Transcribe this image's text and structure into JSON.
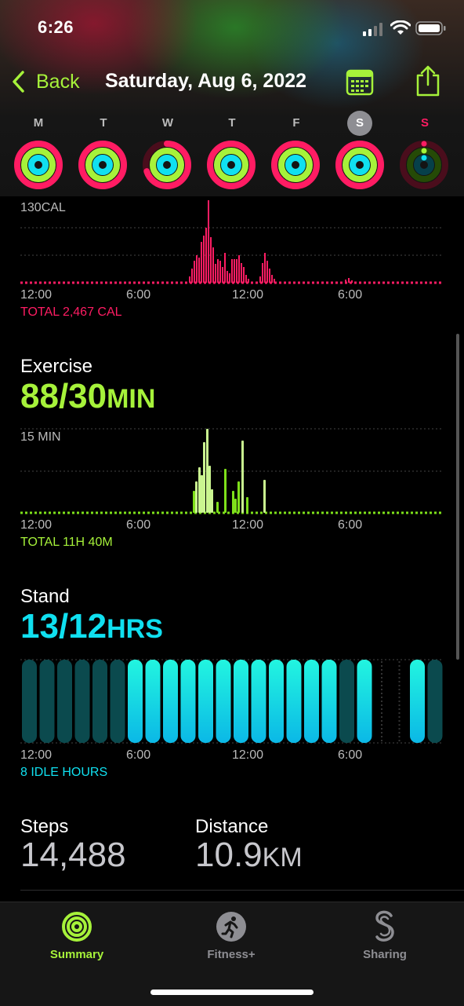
{
  "status": {
    "time": "6:26"
  },
  "nav": {
    "back_label": "Back",
    "title": "Saturday, Aug 6, 2022"
  },
  "week": {
    "days": [
      "M",
      "T",
      "W",
      "T",
      "F",
      "S",
      "S"
    ],
    "selected_index": 5,
    "today_index": 6
  },
  "move": {
    "scale_label": "130CAL",
    "x_labels": [
      "12:00",
      "6:00",
      "12:00",
      "6:00"
    ],
    "total": "TOTAL 2,467 CAL",
    "color": "#ff1c63"
  },
  "exercise": {
    "title": "Exercise",
    "value": "88/30",
    "unit": "MIN",
    "scale_label": "15 MIN",
    "x_labels": [
      "12:00",
      "6:00",
      "12:00",
      "6:00"
    ],
    "total": "TOTAL 11H 40M",
    "color": "#a6f23a"
  },
  "stand": {
    "title": "Stand",
    "value": "13/12",
    "unit": "HRS",
    "x_labels": [
      "12:00",
      "6:00",
      "12:00",
      "6:00"
    ],
    "idle": "8 IDLE HOURS",
    "color": "#10e0f0"
  },
  "steps": {
    "title": "Steps",
    "value": "14,488"
  },
  "distance": {
    "title": "Distance",
    "value": "10.9",
    "unit": "KM"
  },
  "tabs": [
    {
      "label": "Summary",
      "icon": "activity-rings-icon",
      "active": true
    },
    {
      "label": "Fitness+",
      "icon": "running-figure-icon",
      "active": false
    },
    {
      "label": "Sharing",
      "icon": "sharing-icon",
      "active": false
    }
  ]
}
